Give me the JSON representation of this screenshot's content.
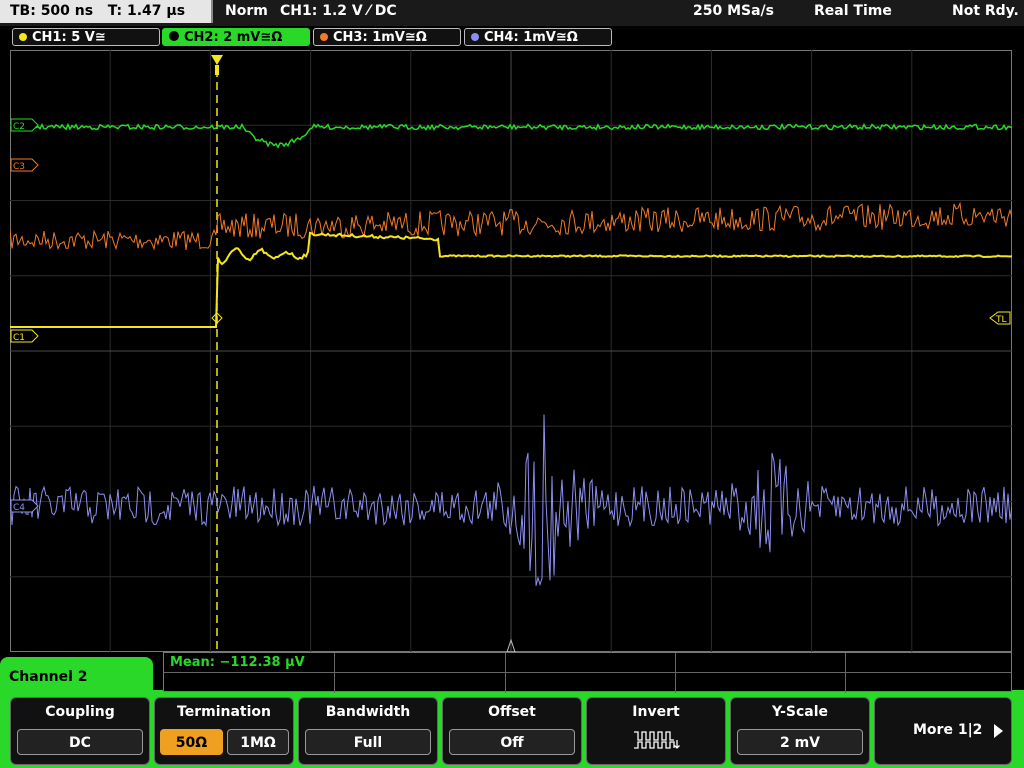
{
  "status_bar": {
    "timebase": "TB: 500 ns",
    "trigger_time": "T: 1.47 µs",
    "mode": "Norm",
    "trigger": "CH1: 1.2 V ⁄ DC",
    "sample_rate": "250 MSa/s",
    "acq_mode": "Real Time",
    "state": "Not Rdy."
  },
  "channels": [
    {
      "label": "CH1: 5 V≅",
      "color": "#f5e61b",
      "active": false
    },
    {
      "label": "CH2: 2 mV≅Ω",
      "color": "#29d829",
      "active": true
    },
    {
      "label": "CH3: 1mV≅Ω",
      "color": "#f07a2a",
      "active": false
    },
    {
      "label": "CH4: 1mV≅Ω",
      "color": "#8e8ef0",
      "active": false
    }
  ],
  "markers": {
    "c2": "C2",
    "c3": "C3",
    "c1": "C1",
    "c4": "C4",
    "trigger_level": "TL"
  },
  "menu_title": "Channel 2",
  "measurement": {
    "text": "Mean: −112.38 µV"
  },
  "softkeys": {
    "coupling": {
      "title": "Coupling",
      "value": "DC"
    },
    "termination": {
      "title": "Termination",
      "options": [
        "50Ω",
        "1MΩ"
      ],
      "selected": "50Ω"
    },
    "bandwidth": {
      "title": "Bandwidth",
      "value": "Full"
    },
    "offset": {
      "title": "Offset",
      "value": "Off"
    },
    "invert": {
      "title": "Invert"
    },
    "yscale": {
      "title": "Y-Scale",
      "value": "2 mV"
    },
    "more": {
      "label": "More 1|2"
    }
  }
}
